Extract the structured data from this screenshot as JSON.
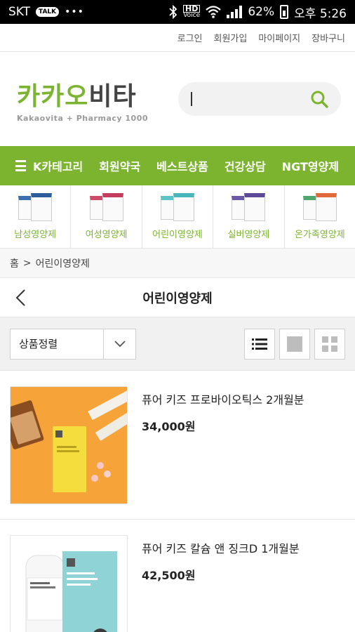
{
  "status": {
    "carrier": "SKT",
    "talk": "TALK",
    "dots": "•••",
    "hd_top": "HD",
    "hd_bottom": "Voice",
    "battery": "62%",
    "time": "오후 5:26"
  },
  "toplinks": [
    "로그인",
    "회원가입",
    "마이페이지",
    "장바구니"
  ],
  "logo": {
    "part1": "카카오",
    "part2": "비타",
    "sub": "Kakaovita + Pharmacy 1000"
  },
  "search": {
    "placeholder": ""
  },
  "nav": [
    "K카테고리",
    "회원약국",
    "베스트상품",
    "건강상담",
    "NGT영양제"
  ],
  "categories": [
    "남성영양제",
    "여성영양제",
    "어린이영양제",
    "실버영양제",
    "온가족영양제"
  ],
  "breadcrumb": {
    "home": "홈",
    "sep": ">",
    "current": "어린이영양제"
  },
  "page_title": "어린이영양제",
  "sort": {
    "label": "상품정렬"
  },
  "products": [
    {
      "name": "퓨어 키즈 프로바이오틱스 2개월분",
      "price": "34,000원"
    },
    {
      "name": "퓨어 키즈 칼슘 앤 징크D 1개월분",
      "price": "42,500원"
    }
  ],
  "colors": {
    "brand": "#7cb42f",
    "logo_dark": "#444444"
  }
}
